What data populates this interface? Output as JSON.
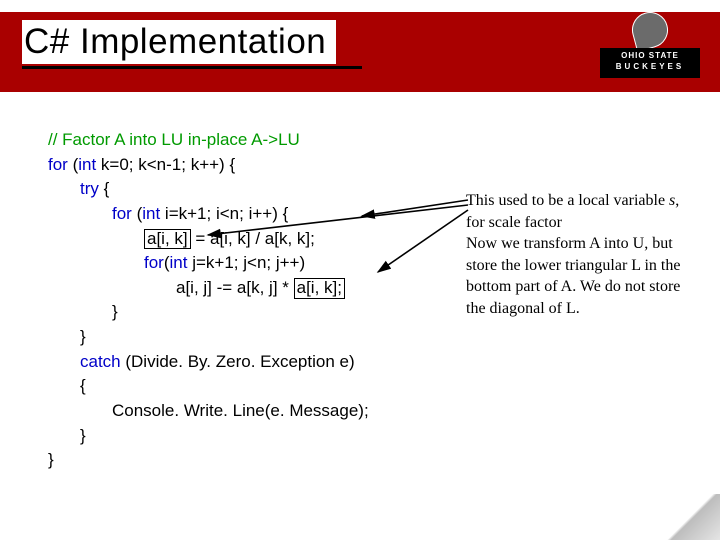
{
  "title": "C# Implementation",
  "logo": {
    "top": "OHIO STATE",
    "bottom": "BUCKEYES"
  },
  "code": {
    "c0": "//  Factor A into LU in-place A->LU",
    "c1a": "for",
    "c1b": " (",
    "c1c": "int",
    "c1d": " k=0; k<n-1; k++)  {",
    "c2a": "try",
    "c2b": " {",
    "c3a": "for",
    "c3b": " (",
    "c3c": "int",
    "c3d": " i=k+1; i<n; i++)  {",
    "c4a": "a[i, k]",
    "c4b": " = a[i, k] / a[k, k];",
    "c5a": "for",
    "c5b": "(",
    "c5c": "int",
    "c5d": " j=k+1; j<n; j++)",
    "c6a": "a[i, j] -= a[k, j] * ",
    "c6b": "a[i, k];",
    "c7": "}",
    "c8": "}",
    "c9a": "catch",
    "c9b": " (Divide. By. Zero. Exception e)",
    "c10": "{",
    "c11": "Console. Write. Line(e. Message);",
    "c12": "}",
    "c13": "}"
  },
  "annotation": {
    "p1a": "This used to be a local variable ",
    "p1b": "s",
    "p1c": ", for scale factor",
    "p2": "Now we transform A into U, but store the lower triangular L in the bottom part of A. We do not store the diagonal of L."
  }
}
